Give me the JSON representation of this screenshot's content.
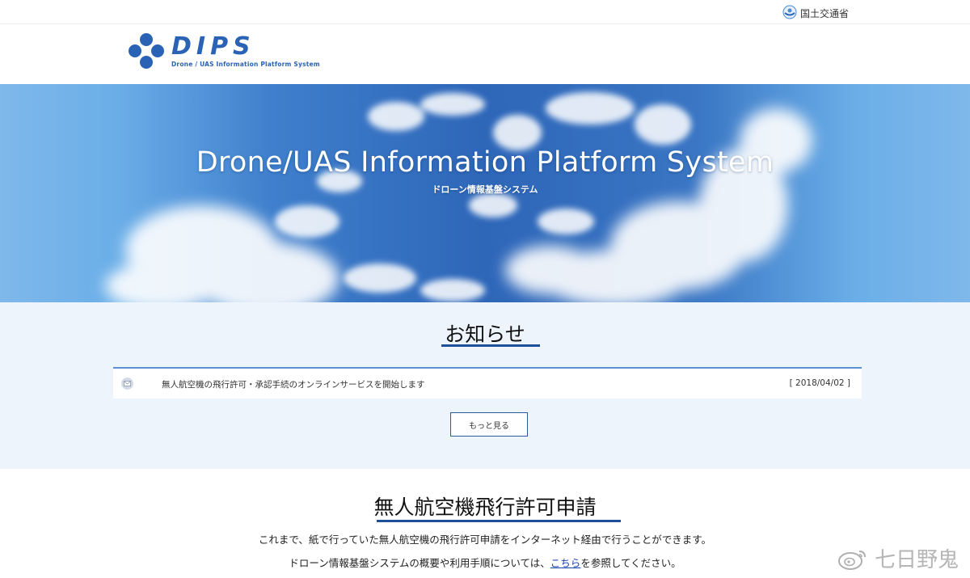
{
  "topbar": {
    "ministry_label": "国土交通省"
  },
  "header": {
    "logo_word": "DIPS",
    "logo_sub": "Drone / UAS Information Platform System"
  },
  "hero": {
    "title": "Drone/UAS Information Platform System",
    "subtitle": "ドローン情報基盤システム"
  },
  "news": {
    "heading": "お知らせ",
    "items": [
      {
        "text": "無人航空機の飛行許可・承認手続のオンラインサービスを開始します",
        "date": "[ 2018/04/02 ]"
      }
    ],
    "more_label": "もっと見る"
  },
  "apply": {
    "heading": "無人航空機飛行許可申請",
    "line1": "これまで、紙で行っていた無人航空機の飛行許可申請をインターネット経由で行うことができます。",
    "line2_before": "ドローン情報基盤システムの概要や利用手順については、",
    "line2_link": "こちら",
    "line2_after": "を参照してください。"
  },
  "watermark": {
    "text": "七日野鬼"
  },
  "colors": {
    "brand_blue": "#2a63b5",
    "accent_navy": "#1e4f9a",
    "news_bg": "#edf4fb",
    "link": "#1a3fb0"
  },
  "icons": {
    "ministry": "ministry-logo-icon",
    "news": "mail-icon",
    "watermark": "weibo-icon"
  }
}
